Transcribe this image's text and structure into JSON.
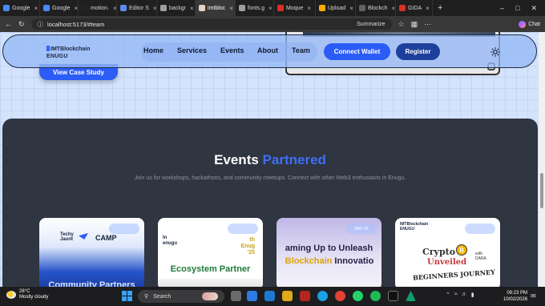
{
  "browser": {
    "tabs": [
      {
        "label": "Google",
        "fav": "#4a8af4"
      },
      {
        "label": "Google",
        "fav": "#4a8af4"
      },
      {
        "label": "motion.",
        "fav": "#222222"
      },
      {
        "label": "Editor S",
        "fav": "#5b8def"
      },
      {
        "label": "backgr",
        "fav": "#9aa0a6"
      },
      {
        "label": "imtbloc",
        "fav": "#e8d3c0",
        "active": true
      },
      {
        "label": "fonts.g",
        "fav": "#9aa0a6"
      },
      {
        "label": "Moque",
        "fav": "#d93025"
      },
      {
        "label": "Upload",
        "fav": "#f9ab00"
      },
      {
        "label": "Blockch",
        "fav": "#5f6368"
      },
      {
        "label": "GIDA",
        "fav": "#d93025"
      }
    ],
    "url": "localhost:5173/#team",
    "summarize_label": "Summarize",
    "chat_label": "Chat"
  },
  "nav": {
    "logo_line1_prefix": "IMT",
    "logo_line1_rest": "Blockchain",
    "logo_line2": "ENUGU",
    "links": [
      "Home",
      "Services",
      "Events",
      "About",
      "Team"
    ],
    "connect_label": "Connect Wallet",
    "register_label": "Register"
  },
  "hero": {
    "case_study_label": "View Case Study"
  },
  "events": {
    "title_part1": "Events",
    "title_part2": "Partnered",
    "subtitle": "Join us for workshops, hackathons, and community meetups. Connect with other Web3 enthusiasts in Enugu.",
    "cards": [
      {
        "badge": "",
        "t1": "Techy\nJaunt",
        "camp": "CAMP",
        "caption": "Community Partners"
      },
      {
        "badge": "",
        "t1": "In\nenugu",
        "t2": "th\nEnug\n'25",
        "caption": "Ecosystem Partner"
      },
      {
        "badge": "MAY 15",
        "caption_line1": "aming Up to Unleash",
        "caption_line2_a": "Blockchain",
        "caption_line2_b": "Innovatio"
      },
      {
        "badge": "",
        "t1": "IMTBlockchain\nENUGU",
        "crypto": "Crypto",
        "coin": "B",
        "unveiled": "Unveiled",
        "journey": "BEGINNERS JOURNEY",
        "note": "with\nDARA"
      }
    ]
  },
  "taskbar": {
    "temperature": "28°C",
    "weather": "Mostly cloudy",
    "search_label": "Search",
    "time": "09:23 PM",
    "date": "10/02/2026"
  },
  "colors": {
    "accent": "#2b5cf6",
    "events_bg": "#2f3541",
    "accent_text": "#3f6ff6"
  }
}
